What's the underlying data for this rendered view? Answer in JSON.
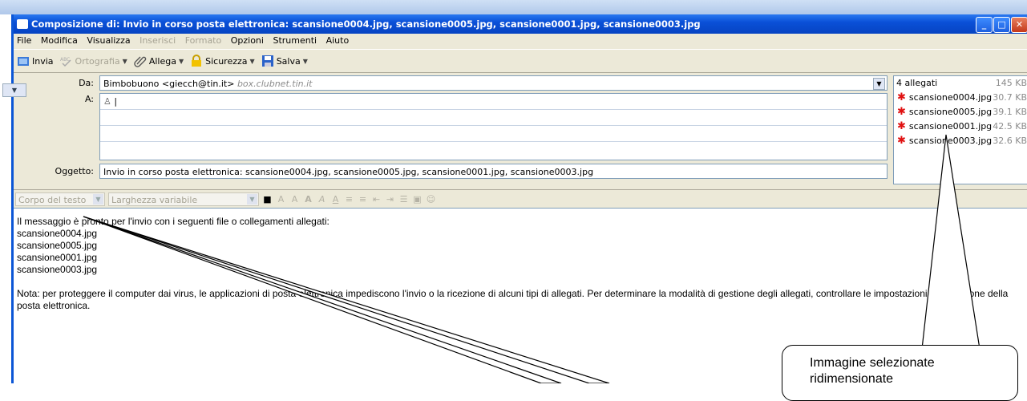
{
  "window": {
    "title": "Composizione di: Invio in corso posta elettronica: scansione0004.jpg, scansione0005.jpg, scansione0001.jpg, scansione0003.jpg"
  },
  "menu": {
    "items": [
      {
        "label": "File",
        "disabled": false
      },
      {
        "label": "Modifica",
        "disabled": false
      },
      {
        "label": "Visualizza",
        "disabled": false
      },
      {
        "label": "Inserisci",
        "disabled": true
      },
      {
        "label": "Formato",
        "disabled": true
      },
      {
        "label": "Opzioni",
        "disabled": false
      },
      {
        "label": "Strumenti",
        "disabled": false
      },
      {
        "label": "Aiuto",
        "disabled": false
      }
    ]
  },
  "toolbar": {
    "send": "Invia",
    "spelling": "Ortografia",
    "attach": "Allega",
    "security": "Sicurezza",
    "save": "Salva"
  },
  "header": {
    "from_label": "Da:",
    "from_value": "Bimbobuono <giecch@tin.it>",
    "from_hint": "box.clubnet.tin.it",
    "to_label": "A:",
    "subject_label": "Oggetto:",
    "subject_value": "Invio in corso posta elettronica: scansione0004.jpg, scansione0005.jpg, scansione0001.jpg, scansione0003.jpg"
  },
  "attachments": {
    "count_label": "4 allegati",
    "total_size": "145 KB",
    "files": [
      {
        "name": "scansione0004.jpg",
        "size": "30.7 KB"
      },
      {
        "name": "scansione0005.jpg",
        "size": "39.1 KB"
      },
      {
        "name": "scansione0001.jpg",
        "size": "42.5 KB"
      },
      {
        "name": "scansione0003.jpg",
        "size": "32.6 KB"
      }
    ]
  },
  "format": {
    "style": "Corpo del testo",
    "font": "Larghezza variabile"
  },
  "body": {
    "lines": [
      "Il messaggio è pronto per l'invio con i seguenti file o collegamenti allegati:",
      "scansione0004.jpg",
      "scansione0005.jpg",
      "scansione0001.jpg",
      "scansione0003.jpg",
      "",
      "Nota: per proteggere il computer dai virus, le applicazioni di posta elettronica impediscono l'invio o la ricezione di alcuni tipi di allegati. Per determinare la modalità di gestione degli allegati, controllare le impostazioni di protezione della posta elettronica."
    ]
  },
  "callout": {
    "text": "Immagine selezionate ridimensionate"
  }
}
